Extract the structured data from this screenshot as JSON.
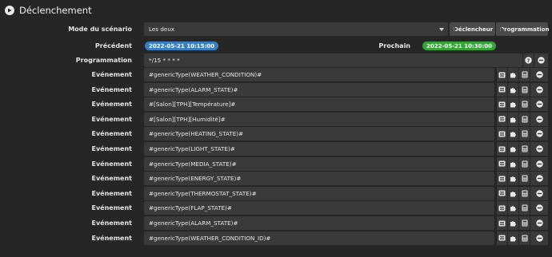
{
  "header": {
    "title": "Déclenchement"
  },
  "mode": {
    "label": "Mode du scénario",
    "value": "Les deux",
    "buttons": {
      "trigger": "Déclencheur",
      "schedule": "Programmation"
    }
  },
  "previous": {
    "label": "Précédent",
    "value": "2022-05-21 10:15:00"
  },
  "next": {
    "label": "Prochain",
    "value": "2022-05-21 10:30:00"
  },
  "programming": {
    "label": "Programmation",
    "value": "*/15 * * * *"
  },
  "events": {
    "label": "Evénement",
    "items": [
      "#genericType(WEATHER_CONDITION)#",
      "#genericType(ALARM_STATE)#",
      "#[Salon][TPH][Température]#",
      "#[Salon][TPH][Humidité]#",
      "#genericType(HEATING_STATE)#",
      "#genericType(LIGHT_STATE)#",
      "#genericType(MEDIA_STATE)#",
      "#genericType(ENERGY_STATE)#",
      "#genericType(THERMOSTAT_STATE)#",
      "#genericType(FLAP_STATE)#",
      "#genericType(ALARM_STATE)#",
      "#genericType(WEATHER_CONDITION_ID)#"
    ]
  },
  "colors": {
    "background": "#262626",
    "field": "#3a3a3a",
    "badge_previous": "#3a7fc1",
    "badge_next": "#38a33a"
  },
  "icons": [
    "play-circle-icon",
    "plus-icon",
    "caret-down-icon",
    "help-icon",
    "list-icon",
    "puzzle-icon",
    "calculator-icon",
    "minus-icon"
  ]
}
